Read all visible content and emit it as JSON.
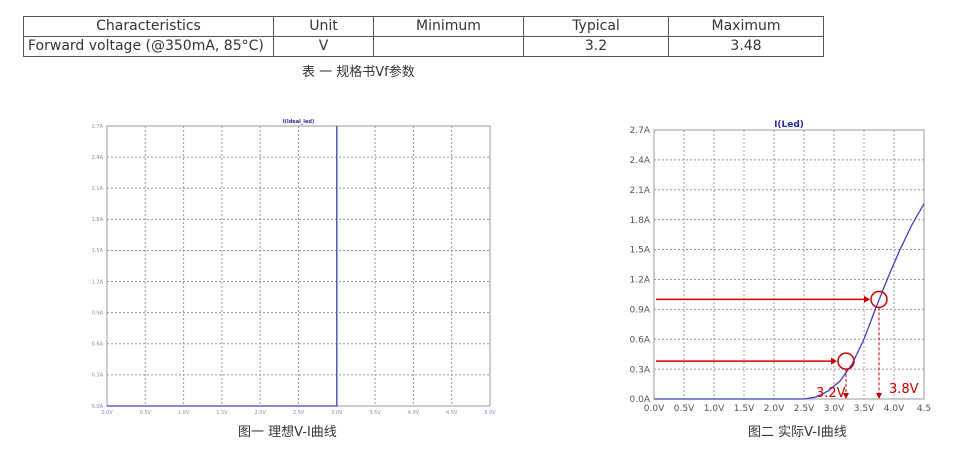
{
  "table": {
    "headers": [
      "Characteristics",
      "Unit",
      "Minimum",
      "Typical",
      "Maximum"
    ],
    "rows": [
      [
        "Forward voltage (@350mA, 85°C)",
        "V",
        "",
        "3.2",
        "3.48"
      ]
    ],
    "caption": "表 一 规格书Vf参数"
  },
  "figures": {
    "ideal_caption": "图一 理想V-I曲线",
    "actual_caption": "图二 实际V-I曲线"
  },
  "chart_data": [
    {
      "type": "line",
      "title": "I(Ideal_led)",
      "xlabel": "",
      "ylabel": "",
      "x_ticks": [
        "0.0V",
        "0.5V",
        "1.0V",
        "1.5V",
        "2.0V",
        "2.5V",
        "3.0V",
        "3.5V",
        "4.0V",
        "4.5V",
        "5.0V"
      ],
      "y_ticks": [
        "0.0A",
        "0.3A",
        "0.6A",
        "0.9A",
        "1.2A",
        "1.5A",
        "1.8A",
        "2.1A",
        "2.4A",
        "2.7A"
      ],
      "xlim": [
        0,
        5.0
      ],
      "ylim": [
        0,
        2.7
      ],
      "grid": true,
      "series": [
        {
          "x": [
            0,
            3.0,
            3.0
          ],
          "y": [
            0,
            0,
            2.7
          ],
          "color": "#4040c0"
        }
      ]
    },
    {
      "type": "line",
      "title": "I(Led)",
      "xlabel": "",
      "ylabel": "",
      "x_ticks": [
        "0.0V",
        "0.5V",
        "1.0V",
        "1.5V",
        "2.0V",
        "2.5V",
        "3.0V",
        "3.5V",
        "4.0V",
        "4.5"
      ],
      "y_ticks": [
        "0.0A",
        "0.3A",
        "0.6A",
        "0.9A",
        "1.2A",
        "1.5A",
        "1.8A",
        "2.1A",
        "2.4A",
        "2.7A"
      ],
      "xlim": [
        0,
        4.5
      ],
      "ylim": [
        0,
        2.7
      ],
      "grid": true,
      "series": [
        {
          "x": [
            0,
            2.5,
            2.7,
            2.9,
            3.1,
            3.3,
            3.5,
            3.7,
            3.9,
            4.1,
            4.3,
            4.5
          ],
          "y": [
            0,
            0,
            0.02,
            0.08,
            0.18,
            0.35,
            0.6,
            0.92,
            1.22,
            1.5,
            1.75,
            1.96
          ],
          "color": "#4040c0"
        }
      ],
      "annotations": [
        {
          "label": "3.2V",
          "x": 3.2,
          "y": 0.38,
          "color": "#cc0000"
        },
        {
          "label": "3.8V",
          "x": 3.75,
          "y": 1.0,
          "color": "#cc0000"
        }
      ]
    }
  ]
}
